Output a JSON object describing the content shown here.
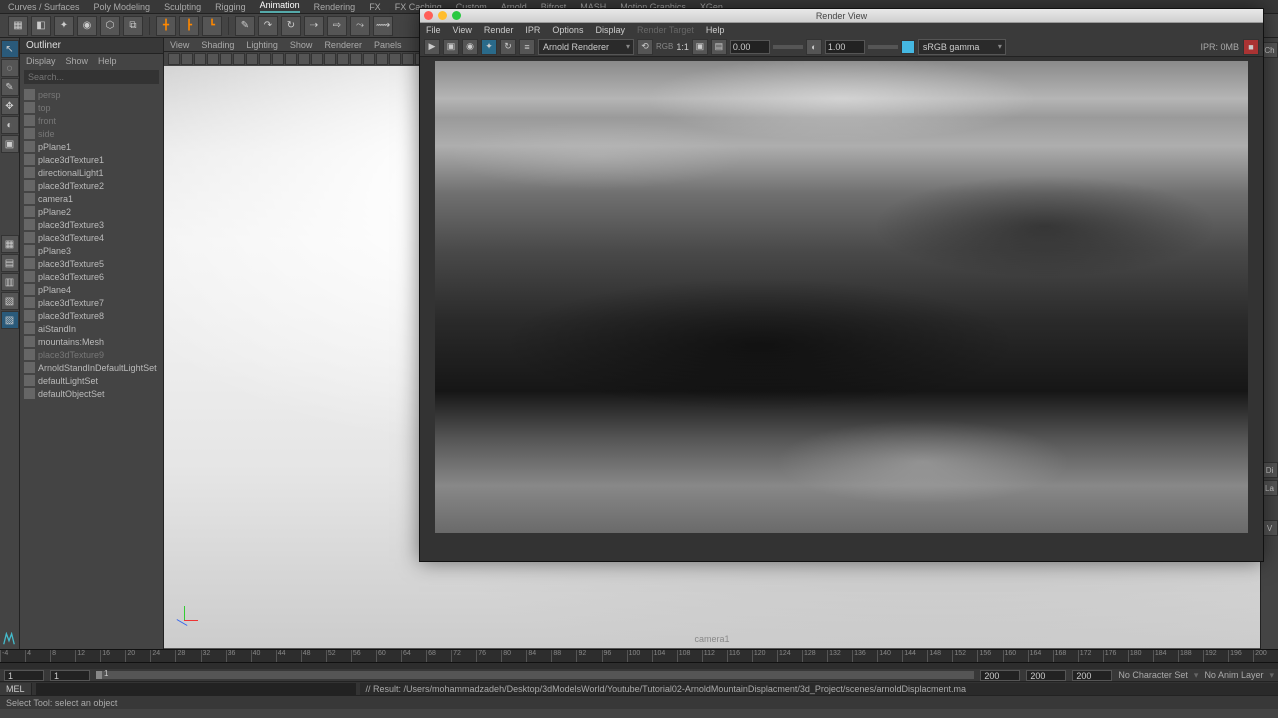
{
  "topMenu": {
    "items": [
      "Curves / Surfaces",
      "Poly Modeling",
      "Sculpting",
      "Rigging",
      "Animation",
      "Rendering",
      "FX",
      "FX Caching",
      "Custom",
      "Arnold",
      "Bifrost",
      "MASH",
      "Motion Graphics",
      "XGen"
    ],
    "active": "Animation"
  },
  "outliner": {
    "title": "Outliner",
    "menu": [
      "Display",
      "Show",
      "Help"
    ],
    "searchPlaceholder": "Search...",
    "items": [
      {
        "label": "persp",
        "dim": true
      },
      {
        "label": "top",
        "dim": true
      },
      {
        "label": "front",
        "dim": true
      },
      {
        "label": "side",
        "dim": true
      },
      {
        "label": "pPlane1"
      },
      {
        "label": "place3dTexture1"
      },
      {
        "label": "directionalLight1"
      },
      {
        "label": "place3dTexture2"
      },
      {
        "label": "camera1"
      },
      {
        "label": "pPlane2"
      },
      {
        "label": "place3dTexture3"
      },
      {
        "label": "place3dTexture4"
      },
      {
        "label": "pPlane3"
      },
      {
        "label": "place3dTexture5"
      },
      {
        "label": "place3dTexture6"
      },
      {
        "label": "pPlane4"
      },
      {
        "label": "place3dTexture7"
      },
      {
        "label": "place3dTexture8"
      },
      {
        "label": "aiStandIn"
      },
      {
        "label": "mountains:Mesh"
      },
      {
        "label": "place3dTexture9",
        "dim": true
      },
      {
        "label": "ArnoldStandInDefaultLightSet"
      },
      {
        "label": "defaultLightSet"
      },
      {
        "label": "defaultObjectSet"
      }
    ]
  },
  "viewportPanel": {
    "menu": [
      "View",
      "Shading",
      "Lighting",
      "Show",
      "Renderer",
      "Panels"
    ],
    "camLabel": "camera1"
  },
  "renderView": {
    "title": "Render View",
    "menu": [
      "File",
      "View",
      "Render",
      "IPR",
      "Options",
      "Display",
      "Render Target",
      "Help"
    ],
    "dimMenu": "Render Target",
    "renderer": "Arnold Renderer",
    "rgbLabel": "RGB",
    "ratio": "1:1",
    "exposure": "0.00",
    "gamma": "1.00",
    "colorSpace": "sRGB gamma",
    "iprStatus": "IPR: 0MB"
  },
  "timeline": {
    "ticks": [
      "-4",
      "4",
      "8",
      "12",
      "16",
      "20",
      "24",
      "28",
      "32",
      "36",
      "40",
      "44",
      "48",
      "52",
      "56",
      "60",
      "64",
      "68",
      "72",
      "76",
      "80",
      "84",
      "88",
      "92",
      "96",
      "100",
      "104",
      "108",
      "112",
      "116",
      "120",
      "124",
      "128",
      "132",
      "136",
      "140",
      "144",
      "148",
      "152",
      "156",
      "160",
      "164",
      "168",
      "172",
      "176",
      "180",
      "184",
      "188",
      "192",
      "196",
      "200"
    ],
    "startA": "1",
    "startB": "1",
    "startC": "1",
    "endA": "200",
    "endB": "200",
    "endC": "200",
    "labels": {
      "charSet": "No Character Set",
      "animLayer": "No Anim Layer"
    }
  },
  "mel": {
    "label": "MEL",
    "output": "// Result: /Users/mohammadzadeh/Desktop/3dModelsWorld/Youtube/Tutorial02-ArnoldMountainDisplacment/3d_Project/scenes/arnoldDisplacment.ma"
  },
  "status": "Select Tool: select an object",
  "rightPanelLabels": {
    "ch": "Ch",
    "di": "Di",
    "la": "La",
    "v": "V"
  }
}
